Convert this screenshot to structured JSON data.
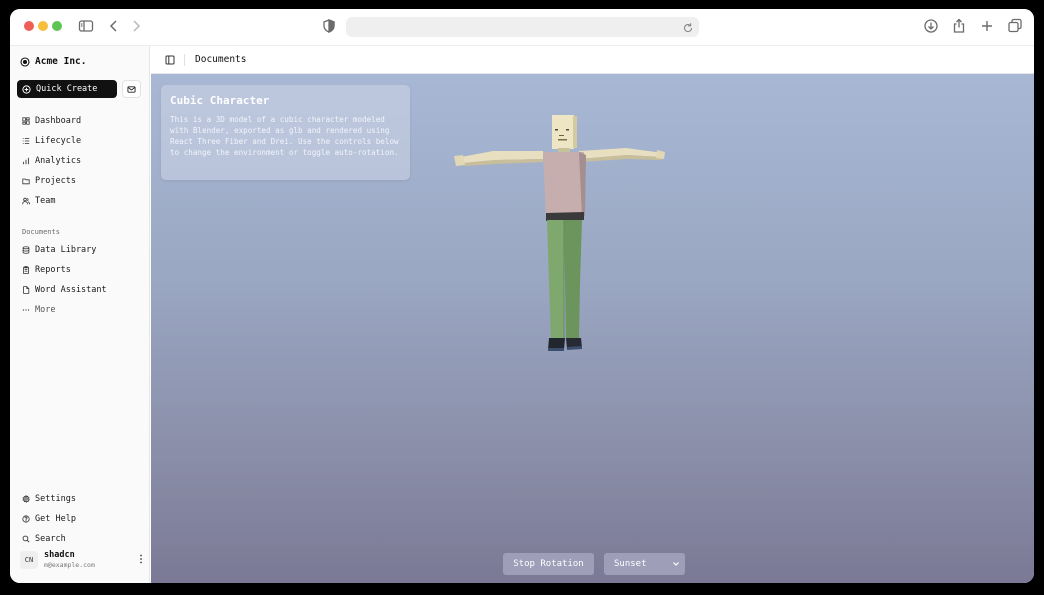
{
  "browser": {
    "address": ""
  },
  "sidebar": {
    "brand": "Acme Inc.",
    "quick_create": "Quick Create",
    "nav": [
      {
        "label": "Dashboard",
        "icon": "dashboard-icon"
      },
      {
        "label": "Lifecycle",
        "icon": "list-icon"
      },
      {
        "label": "Analytics",
        "icon": "chart-icon"
      },
      {
        "label": "Projects",
        "icon": "folder-icon"
      },
      {
        "label": "Team",
        "icon": "users-icon"
      }
    ],
    "documents_label": "Documents",
    "documents": [
      {
        "label": "Data Library",
        "icon": "database-icon"
      },
      {
        "label": "Reports",
        "icon": "clipboard-icon"
      },
      {
        "label": "Word Assistant",
        "icon": "file-icon"
      },
      {
        "label": "More",
        "icon": "ellipsis-icon"
      }
    ],
    "footer": [
      {
        "label": "Settings",
        "icon": "gear-icon"
      },
      {
        "label": "Get Help",
        "icon": "help-icon"
      },
      {
        "label": "Search",
        "icon": "search-icon"
      }
    ],
    "user": {
      "initials": "CN",
      "name": "shadcn",
      "email": "m@example.com"
    }
  },
  "header": {
    "title": "Documents"
  },
  "viewer": {
    "card_title": "Cubic Character",
    "card_description": "This is a 3D model of a cubic character modeled with Blender, exported as glb and rendered using React Three Fiber and Drei. Use the controls below to change the environment or toggle auto-rotation.",
    "stop_rotation": "Stop Rotation",
    "environment": "Sunset"
  },
  "colors": {
    "accent": "#111111",
    "sky_top": "#a8b8d4",
    "sky_bottom": "#7b7995"
  }
}
